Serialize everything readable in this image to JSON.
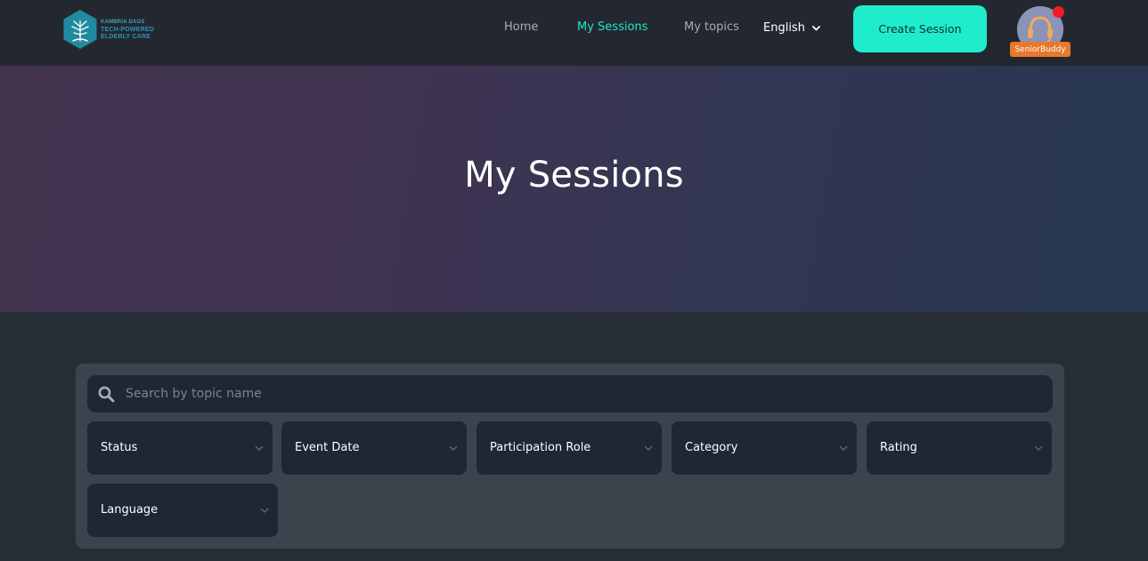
{
  "logo": {
    "line1": "KAMBRIA DAOS",
    "line2": "TECH-POWERED",
    "line3": "ELDERLY CARE"
  },
  "nav": {
    "home": "Home",
    "my_sessions": "My Sessions",
    "my_topics": "My topics"
  },
  "language_selector": {
    "value": "English"
  },
  "create_session_label": "Create Session",
  "user": {
    "badge": "SeniorBuddy"
  },
  "hero": {
    "title": "My Sessions"
  },
  "search": {
    "placeholder": "Search by topic name",
    "value": ""
  },
  "filters": [
    {
      "label": "Status"
    },
    {
      "label": "Event Date"
    },
    {
      "label": "Participation Role"
    },
    {
      "label": "Category"
    },
    {
      "label": "Rating"
    },
    {
      "label": "Language"
    }
  ],
  "colors": {
    "accent": "#1eeccb",
    "badge": "#e8782c",
    "notification": "#ee1d23",
    "logo": "#1f8aa0"
  }
}
